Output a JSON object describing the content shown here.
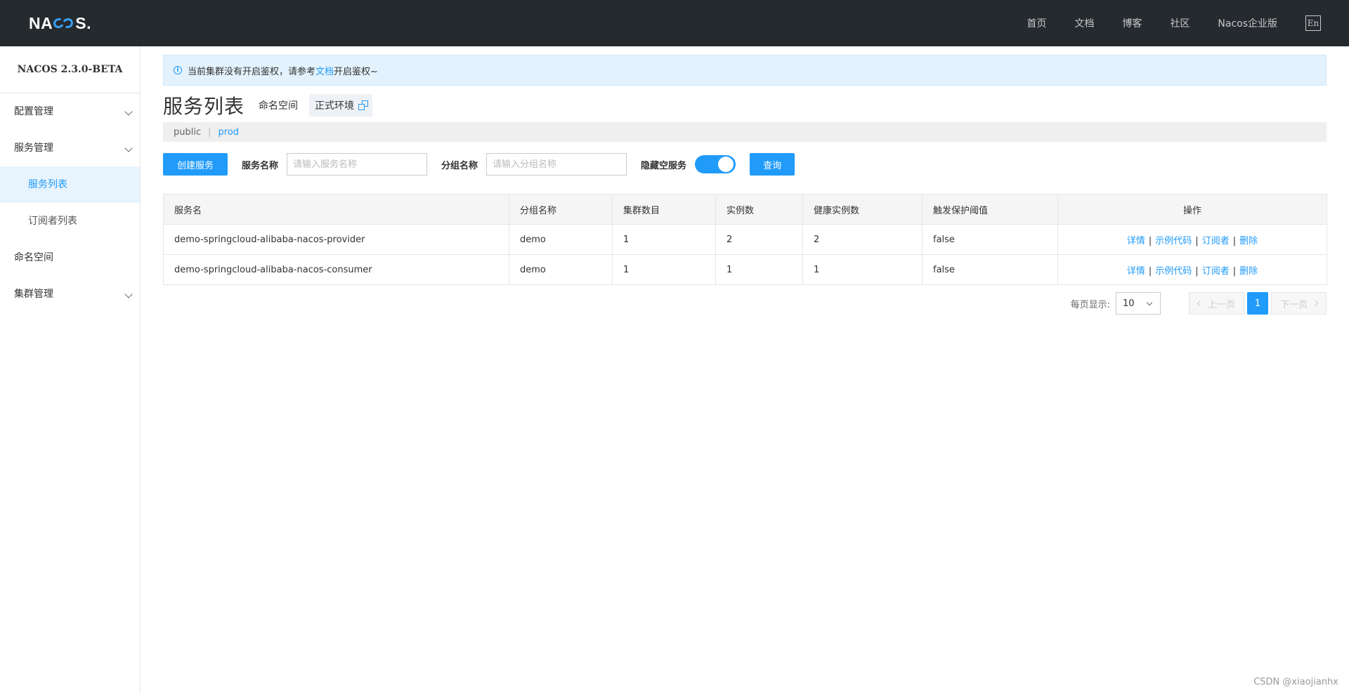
{
  "header": {
    "logo": "NACOS.",
    "logo_parts": [
      "NA",
      "S."
    ],
    "nav": [
      "首页",
      "文档",
      "博客",
      "社区",
      "Nacos企业版"
    ],
    "lang": "En"
  },
  "sidebar": {
    "version": "NACOS 2.3.0-BETA",
    "items": [
      {
        "label": "配置管理",
        "expandable": true
      },
      {
        "label": "服务管理",
        "expandable": true
      },
      {
        "label": "服务列表",
        "sub": true,
        "active": true
      },
      {
        "label": "订阅者列表",
        "sub": true
      },
      {
        "label": "命名空间",
        "expandable": false
      },
      {
        "label": "集群管理",
        "expandable": true
      }
    ]
  },
  "notice": {
    "prefix": "当前集群没有开启鉴权，请参考",
    "link": "文档",
    "suffix": "开启鉴权~"
  },
  "page": {
    "title": "服务列表",
    "namespace_label": "命名空间",
    "namespace_current": "正式环境",
    "namespaces": [
      "public",
      "prod"
    ]
  },
  "filter": {
    "create_button": "创建服务",
    "service_name_label": "服务名称",
    "service_name_placeholder": "请输入服务名称",
    "group_name_label": "分组名称",
    "group_name_placeholder": "请输入分组名称",
    "hide_empty_label": "隐藏空服务",
    "hide_empty_on": true,
    "query_button": "查询"
  },
  "table": {
    "columns": [
      "服务名",
      "分组名称",
      "集群数目",
      "实例数",
      "健康实例数",
      "触发保护阈值",
      "操作"
    ],
    "rows": [
      [
        "demo-springcloud-alibaba-nacos-provider",
        "demo",
        "1",
        "2",
        "2",
        "false"
      ],
      [
        "demo-springcloud-alibaba-nacos-consumer",
        "demo",
        "1",
        "1",
        "1",
        "false"
      ]
    ],
    "ops": [
      "详情",
      "示例代码",
      "订阅者",
      "删除"
    ],
    "ops_separator": "|"
  },
  "pagination": {
    "page_size_label": "每页显示:",
    "page_size": "10",
    "prev": "上一页",
    "current": "1",
    "next": "下一页"
  },
  "watermark": "CSDN @xiaojianhx",
  "colors": {
    "accent": "#209bfa",
    "topbar": "#252a2f",
    "notice_bg": "#e3f2fd"
  }
}
